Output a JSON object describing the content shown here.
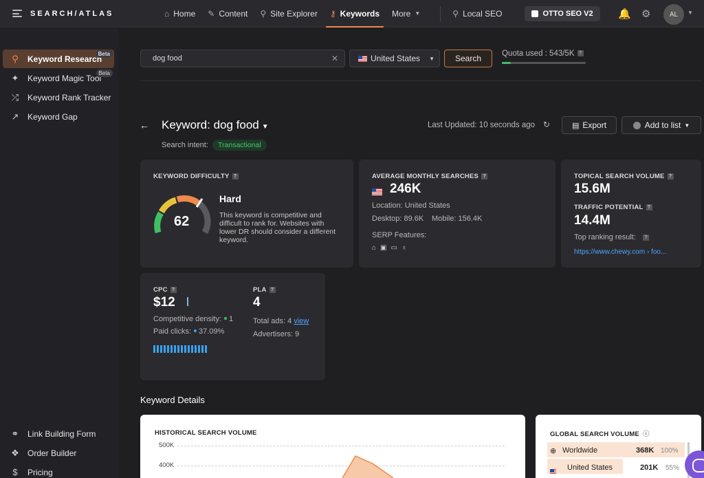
{
  "nav": {
    "logo": "SEARCH/ATLAS",
    "items": [
      {
        "label": "Home",
        "icon": "home-icon"
      },
      {
        "label": "Content",
        "icon": "pen-icon"
      },
      {
        "label": "Site Explorer",
        "icon": "magnifier-icon"
      },
      {
        "label": "Keywords",
        "icon": "key-icon",
        "active": true
      },
      {
        "label": "More",
        "icon": "chevron-down-icon"
      }
    ],
    "local_seo": "Local SEO",
    "otto": "OTTO SEO V2",
    "avatar": "AL"
  },
  "sidebar": {
    "items": [
      {
        "label": "Keyword Research",
        "badge": "Beta",
        "active": true
      },
      {
        "label": "Keyword Magic Tool",
        "badge": "Beta"
      },
      {
        "label": "Keyword Rank Tracker"
      },
      {
        "label": "Keyword Gap"
      }
    ],
    "bottom": [
      {
        "label": "Link Building Form"
      },
      {
        "label": "Order Builder"
      },
      {
        "label": "Pricing"
      }
    ]
  },
  "search": {
    "value": "dog food",
    "country": "United States",
    "button": "Search",
    "quota_label": "Quota used : 543/5K",
    "quota_fraction": 0.11
  },
  "header": {
    "title": "Keyword: dog food",
    "intent_label": "Search intent:",
    "intent": "Transactional",
    "last_updated": "Last Updated: 10 seconds ago",
    "export": "Export",
    "add_to_list": "Add to list"
  },
  "difficulty": {
    "label": "KEYWORD DIFFICULTY",
    "value": "62",
    "level": "Hard",
    "description": "This keyword is competitive and difficult to rank for. Websites with lower DR should consider a different keyword."
  },
  "searches": {
    "label": "AVERAGE MONTHLY SEARCHES",
    "value": "246K",
    "location": "Location: United States",
    "desktop": "Desktop: 89.6K",
    "mobile": "Mobile: 156.4K",
    "serp": "SERP Features:"
  },
  "topical": {
    "label": "TOPICAL SEARCH VOLUME",
    "value": "15.6M",
    "traffic_label": "TRAFFIC POTENTIAL",
    "traffic_value": "14.4M",
    "top_label": "Top ranking result:",
    "top_link": "https://www.chewy.com › foo..."
  },
  "cpc": {
    "label": "CPC",
    "value": "$12",
    "density_label": "Competitive density:",
    "density": "1",
    "paid_label": "Paid clicks:",
    "paid": "37.09%"
  },
  "pla": {
    "label": "PLA",
    "value": "4",
    "ads_label": "Total ads: 4",
    "view": "view",
    "advertisers": "Advertisers: 9"
  },
  "details": {
    "title": "Keyword Details",
    "history_label": "HISTORICAL SEARCH VOLUME",
    "ticks": [
      "500K",
      "400K"
    ],
    "global_label": "GLOBAL SEARCH VOLUME",
    "global": [
      {
        "name": "Worldwide",
        "value": "368K",
        "pct": "100%"
      },
      {
        "name": "United States",
        "value": "201K",
        "pct": "55%"
      }
    ]
  }
}
